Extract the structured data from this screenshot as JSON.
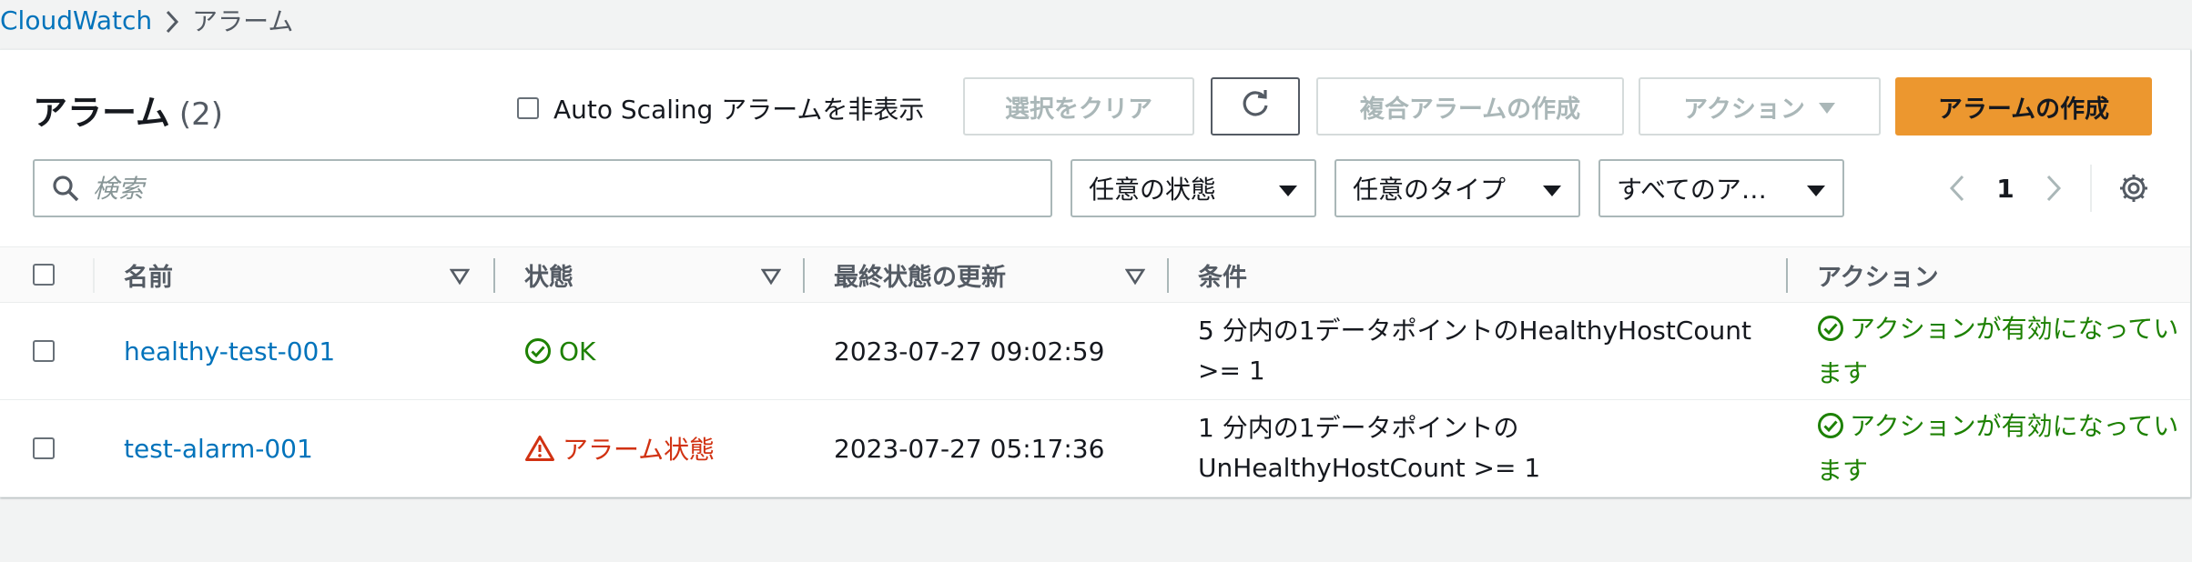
{
  "breadcrumb": {
    "parent": "CloudWatch",
    "current": "アラーム"
  },
  "header": {
    "title": "アラーム",
    "count": "(2)"
  },
  "hide_autoscaling_label": "Auto Scaling アラームを非表示",
  "toolbar": {
    "clear_selection": "選択をクリア",
    "create_composite": "複合アラームの作成",
    "actions": "アクション",
    "create_alarm": "アラームの作成"
  },
  "filters": {
    "search_placeholder": "検索",
    "state": "任意の状態",
    "type": "任意のタイプ",
    "actions": "すべてのア…"
  },
  "pagination": {
    "current_page": "1"
  },
  "table": {
    "headers": {
      "name": "名前",
      "state": "状態",
      "last_update": "最終状態の更新",
      "conditions": "条件",
      "actions": "アクション"
    },
    "rows": [
      {
        "name": "healthy-test-001",
        "state": "OK",
        "last_update": "2023-07-27 09:02:59",
        "condition_line1": "5 分内の1データポイントのHealthyHostCount",
        "condition_line2": ">= 1",
        "actions_line1": "アクションが有効になってい",
        "actions_line2": "ます"
      },
      {
        "name": "test-alarm-001",
        "state": "アラーム状態",
        "last_update": "2023-07-27 05:17:36",
        "condition_line1": "1 分内の1データポイントの",
        "condition_line2": "UnHealthyHostCount >= 1",
        "actions_line1": "アクションが有効になってい",
        "actions_line2": "ます"
      }
    ]
  },
  "colors": {
    "link": "#0073bb",
    "ok": "#1d8102",
    "alarm": "#d13212",
    "primary_button": "#ec972f"
  },
  "icons": {
    "breadcrumb_separator": "chevron-right-icon",
    "refresh": "refresh-icon",
    "search": "search-icon",
    "dropdown": "caret-down-icon",
    "prev_page": "chevron-left-icon",
    "next_page": "chevron-right-icon",
    "settings": "gear-icon",
    "ok_status": "check-circle-icon",
    "alarm_status": "warning-triangle-icon"
  }
}
